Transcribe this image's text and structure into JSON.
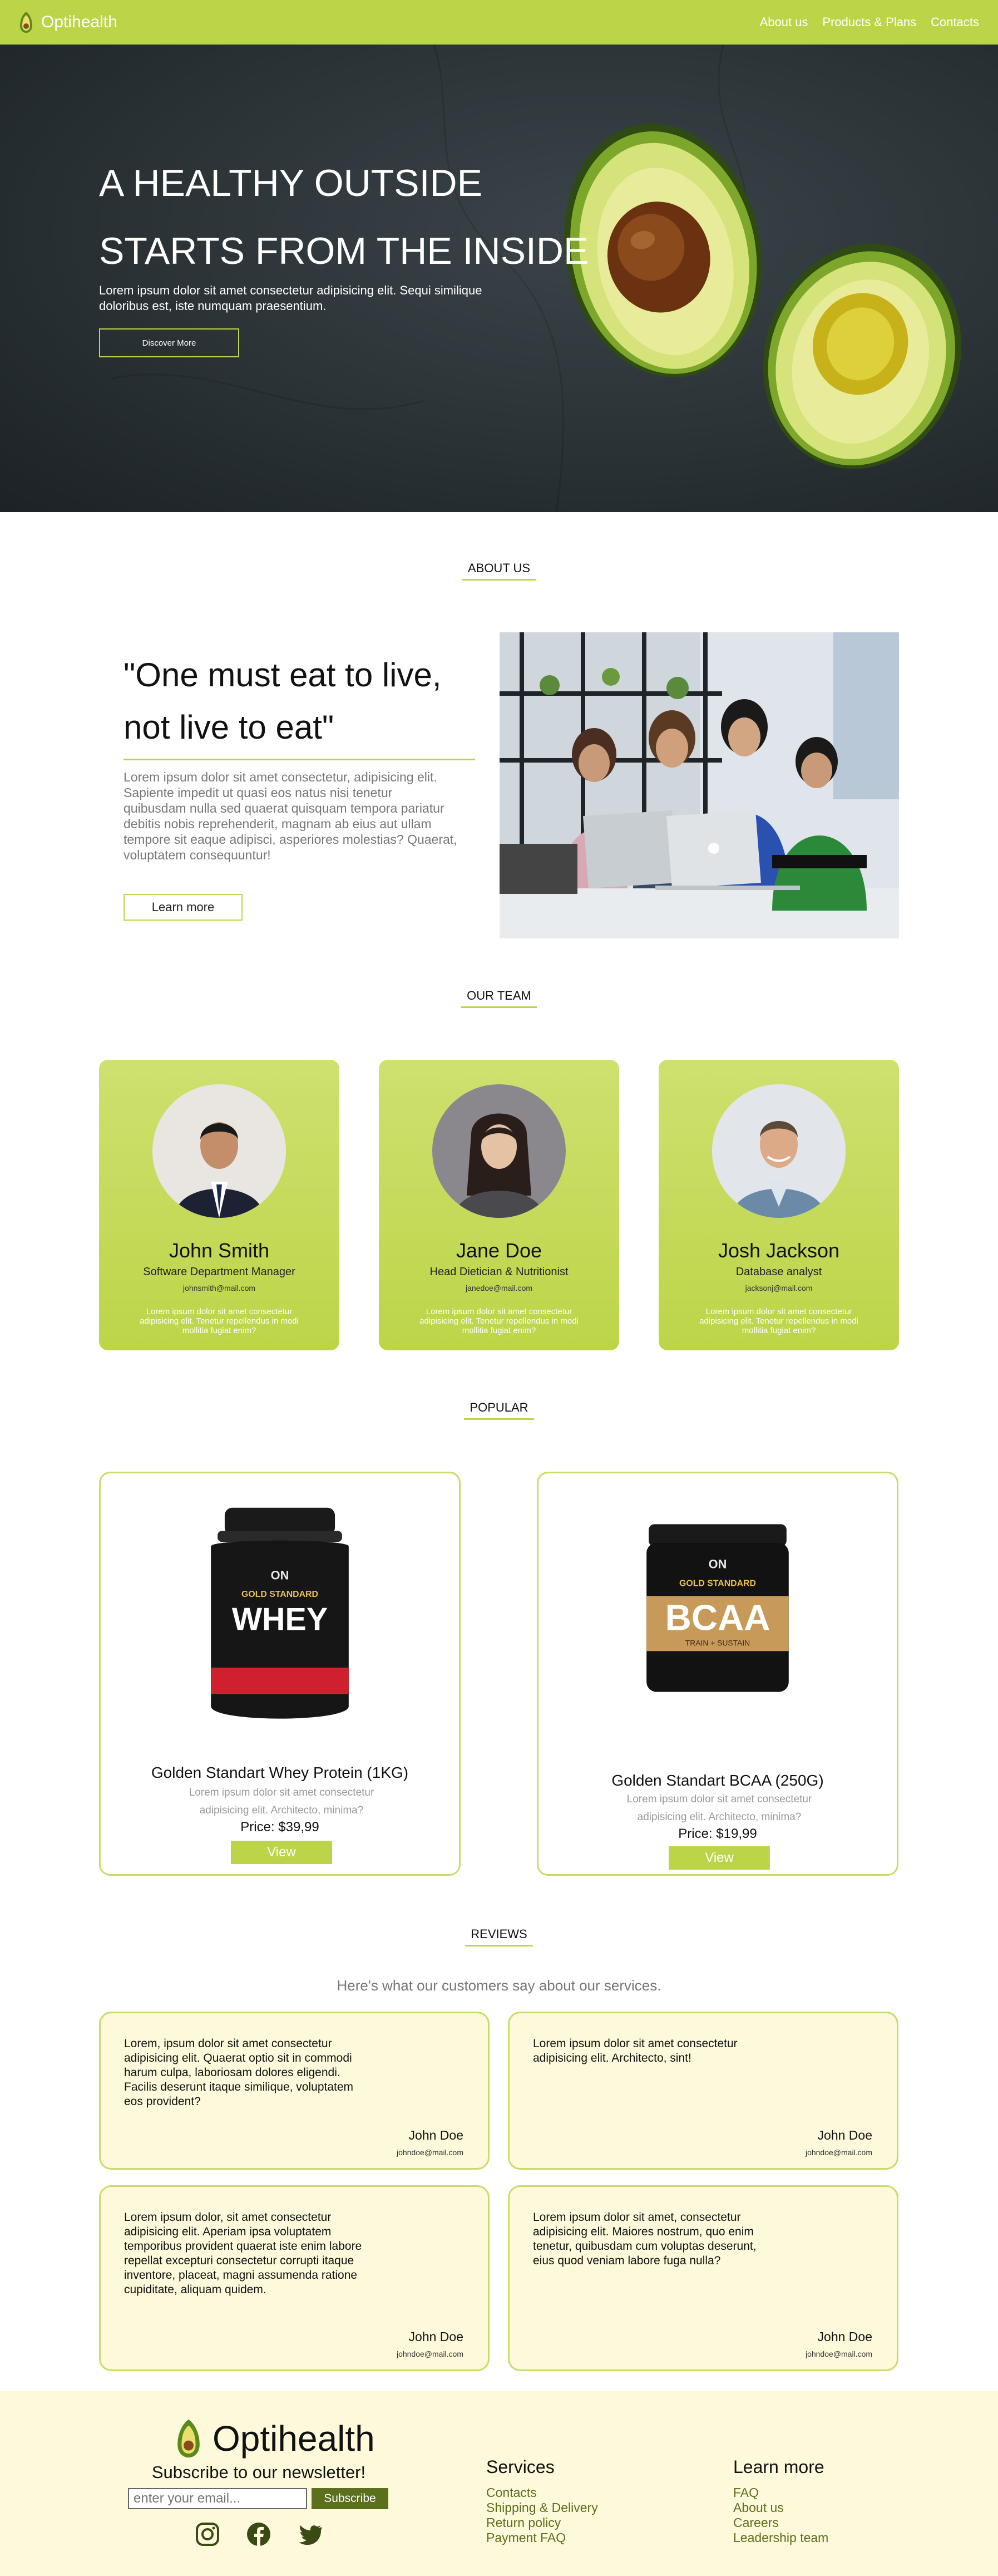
{
  "nav": {
    "brand": "Optihealth",
    "links": [
      "About us",
      "Products & Plans",
      "Contacts"
    ]
  },
  "hero": {
    "title": "A HEALTHY OUTSIDE STARTS FROM THE INSIDE",
    "subtitle": "Lorem ipsum dolor sit amet consectetur adipisicing elit. Sequi similique doloribus est, iste numquam praesentium.",
    "cta": "Discover More"
  },
  "about": {
    "heading": "ABOUT US",
    "quote": "\"One must eat to live, not live to eat\"",
    "text": "Lorem ipsum dolor sit amet consectetur, adipisicing elit. Sapiente impedit ut quasi eos natus nisi tenetur quibusdam nulla sed quaerat quisquam tempora pariatur debitis nobis reprehenderit, magnam ab eius aut ullam tempore sit eaque adipisci, asperiores molestias? Quaerat, voluptatem consequuntur!",
    "button": "Learn more"
  },
  "team": {
    "heading": "OUR TEAM",
    "members": [
      {
        "name": "John Smith",
        "role": "Software Department Manager",
        "email": "johnsmith@mail.com",
        "desc": "Lorem ipsum dolor sit amet consectetur adipisicing elit. Tenetur repellendus in modi mollitia fugiat enim?"
      },
      {
        "name": "Jane Doe",
        "role": "Head Dietician & Nutritionist",
        "email": "janedoe@mail.com",
        "desc": "Lorem ipsum dolor sit amet consectetur adipisicing elit. Tenetur repellendus in modi mollitia fugiat enim?"
      },
      {
        "name": "Josh Jackson",
        "role": "Database analyst",
        "email": "jacksonj@mail.com",
        "desc": "Lorem ipsum dolor sit amet consectetur adipisicing elit. Tenetur repellendus in modi mollitia fugiat enim?"
      }
    ]
  },
  "popular": {
    "heading": "POPULAR",
    "products": [
      {
        "name": "Golden Standart Whey Protein (1KG)",
        "desc": "Lorem ipsum dolor sit amet consectetur adipisicing elit. Architecto, minima?",
        "price": "Price: $39,99",
        "button": "View",
        "label_brand": "ON",
        "label_top": "GOLD STANDARD",
        "label_main": "WHEY"
      },
      {
        "name": "Golden Standart BCAA (250G)",
        "desc": "Lorem ipsum dolor sit amet consectetur adipisicing elit. Architecto, minima?",
        "price": "Price: $19,99",
        "button": "View",
        "label_brand": "ON",
        "label_top": "GOLD STANDARD",
        "label_main": "BCAA",
        "label_sub": "TRAIN + SUSTAIN"
      }
    ]
  },
  "reviews": {
    "heading": "REVIEWS",
    "subtitle": "Here's what our customers say about our services.",
    "items": [
      {
        "text": "Lorem, ipsum dolor sit amet consectetur adipisicing elit. Quaerat optio sit in commodi harum culpa, laboriosam dolores eligendi. Facilis deserunt itaque similique, voluptatem eos provident?",
        "name": "John Doe",
        "email": "johndoe@mail.com"
      },
      {
        "text": "Lorem ipsum dolor sit amet consectetur adipisicing elit. Architecto, sint!",
        "name": "John Doe",
        "email": "johndoe@mail.com"
      },
      {
        "text": "Lorem ipsum dolor, sit amet consectetur adipisicing elit. Aperiam ipsa voluptatem temporibus provident quaerat iste enim labore repellat excepturi consectetur corrupti itaque inventore, placeat, magni assumenda ratione cupiditate, aliquam quidem.",
        "name": "John Doe",
        "email": "johndoe@mail.com"
      },
      {
        "text": "Lorem ipsum dolor sit amet, consectetur adipisicing elit. Maiores nostrum, quo enim tenetur, quibusdam cum voluptas deserunt, eius quod veniam labore fuga nulla?",
        "name": "John Doe",
        "email": "johndoe@mail.com"
      }
    ]
  },
  "footer": {
    "brand": "Optihealth",
    "newsletter": "Subscribe to our newsletter!",
    "email_placeholder": "enter your email...",
    "subscribe": "Subscribe",
    "social_icons": [
      "instagram-icon",
      "facebook-icon",
      "twitter-icon"
    ],
    "services": {
      "heading": "Services",
      "links": [
        "Contacts",
        "Shipping & Delivery",
        "Return policy",
        "Payment FAQ"
      ]
    },
    "learn": {
      "heading": "Learn more",
      "links": [
        "FAQ",
        "About us",
        "Careers",
        "Leadership team"
      ]
    }
  },
  "colors": {
    "accent": "#bcd548",
    "footer_bg": "#fdf9da",
    "button_dark": "#5a701c",
    "hero_bg": "#2a3236"
  }
}
